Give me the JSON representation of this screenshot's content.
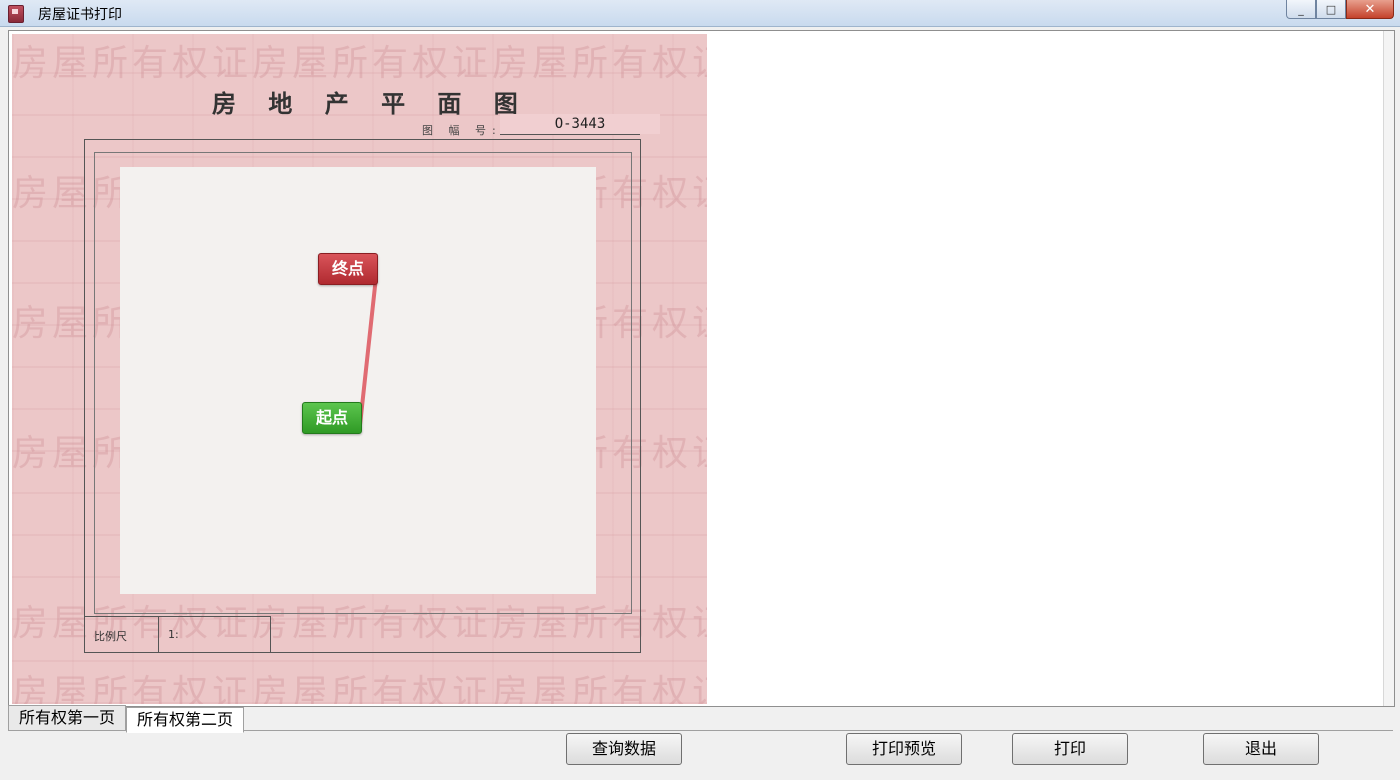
{
  "window": {
    "title": "房屋证书打印",
    "controls": {
      "minimize": "_",
      "maximize": "□",
      "close": "✕"
    }
  },
  "certificate": {
    "title": "房 地 产 平 面 图",
    "sheet_label": "图 幅 号:",
    "sheet_number": "O-3443",
    "scale_label": "比例尺",
    "scale_value": "1:",
    "watermark": "房屋所有权证房屋所有权证房屋所有权证",
    "markers": {
      "end": "终点",
      "start": "起点"
    },
    "route_color": "#e06b72"
  },
  "tabs": [
    {
      "label": "所有权第一页",
      "active": false
    },
    {
      "label": "所有权第二页",
      "active": true
    }
  ],
  "buttons": {
    "query": "查询数据",
    "preview": "打印预览",
    "print": "打印",
    "exit": "退出"
  }
}
